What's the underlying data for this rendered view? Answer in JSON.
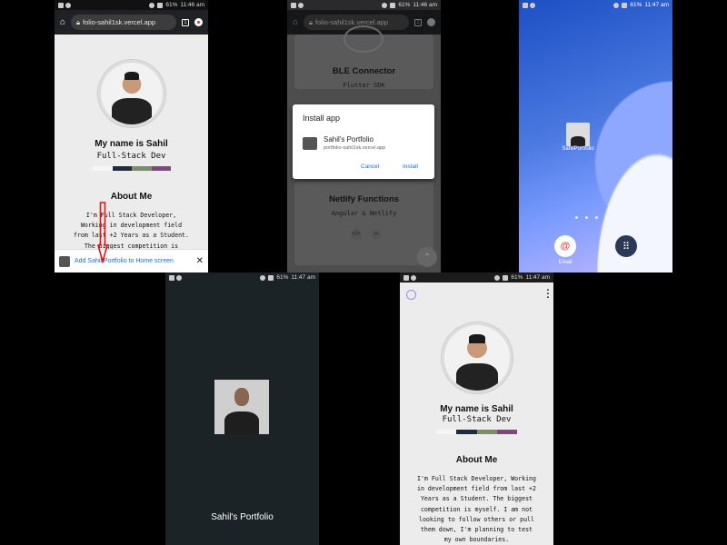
{
  "phone1": {
    "status": {
      "time": "11:46 am",
      "battery": "61%"
    },
    "url": "folio-sahil1sk.vercel.app",
    "tab_count": "1",
    "name": "My name is Sahil",
    "role": "Full-Stack Dev",
    "palette": [
      "#f6f6f6",
      "#1e2b3f",
      "#7c8c6a",
      "#7a4a7a"
    ],
    "about_title": "About Me",
    "about_lines": [
      "I'm Full Stack Developer,",
      "Working in development field",
      "from last +2 Years as a Student.",
      "The biggest competition is"
    ],
    "a2hs_text": "Add Sahil Portfolio to Home screen",
    "close_glyph": "✕",
    "arrow_color": "#e01414"
  },
  "phone2": {
    "status": {
      "time": "11:46 am",
      "battery": "61%"
    },
    "url": "folio-sahil1sk.vercel.app",
    "tab_count": "1",
    "bg1_title": "BLE Connector",
    "bg1_sub": "Flutter SDK",
    "bg2_title": "Netlify Functions",
    "bg2_sub": "Angular & Netlify",
    "dialog": {
      "title": "Install app",
      "app_name": "Sahil's Portfolio",
      "app_url": "portfolio-sahil1sk.vercel.app",
      "cancel": "Cancel",
      "install": "Install"
    }
  },
  "phone3": {
    "status": {
      "time": "11:47 am",
      "battery": "61%"
    },
    "app_label": "SahilPortfolio",
    "dock": [
      {
        "label": "Email",
        "icon": "@",
        "color": "#e84c3d"
      },
      {
        "label": "Apps",
        "icon": "⠿",
        "color": "#2a3a56"
      }
    ]
  },
  "phone4": {
    "status": {
      "time": "11:47 am",
      "battery": "61%"
    },
    "splash_name": "Sahil's Portfolio"
  },
  "phone5": {
    "status": {
      "time": "11:47 am",
      "battery": "61%"
    },
    "name": "My name is Sahil",
    "role": "Full-Stack Dev",
    "about_title": "About Me",
    "about_lines": [
      "I'm Full Stack Developer, Working",
      "in development field from last +2",
      "Years as a Student. The biggest",
      "competition is myself. I am not",
      "looking to follow others or pull",
      "them down, I'm planning to test",
      "my own boundaries."
    ]
  }
}
